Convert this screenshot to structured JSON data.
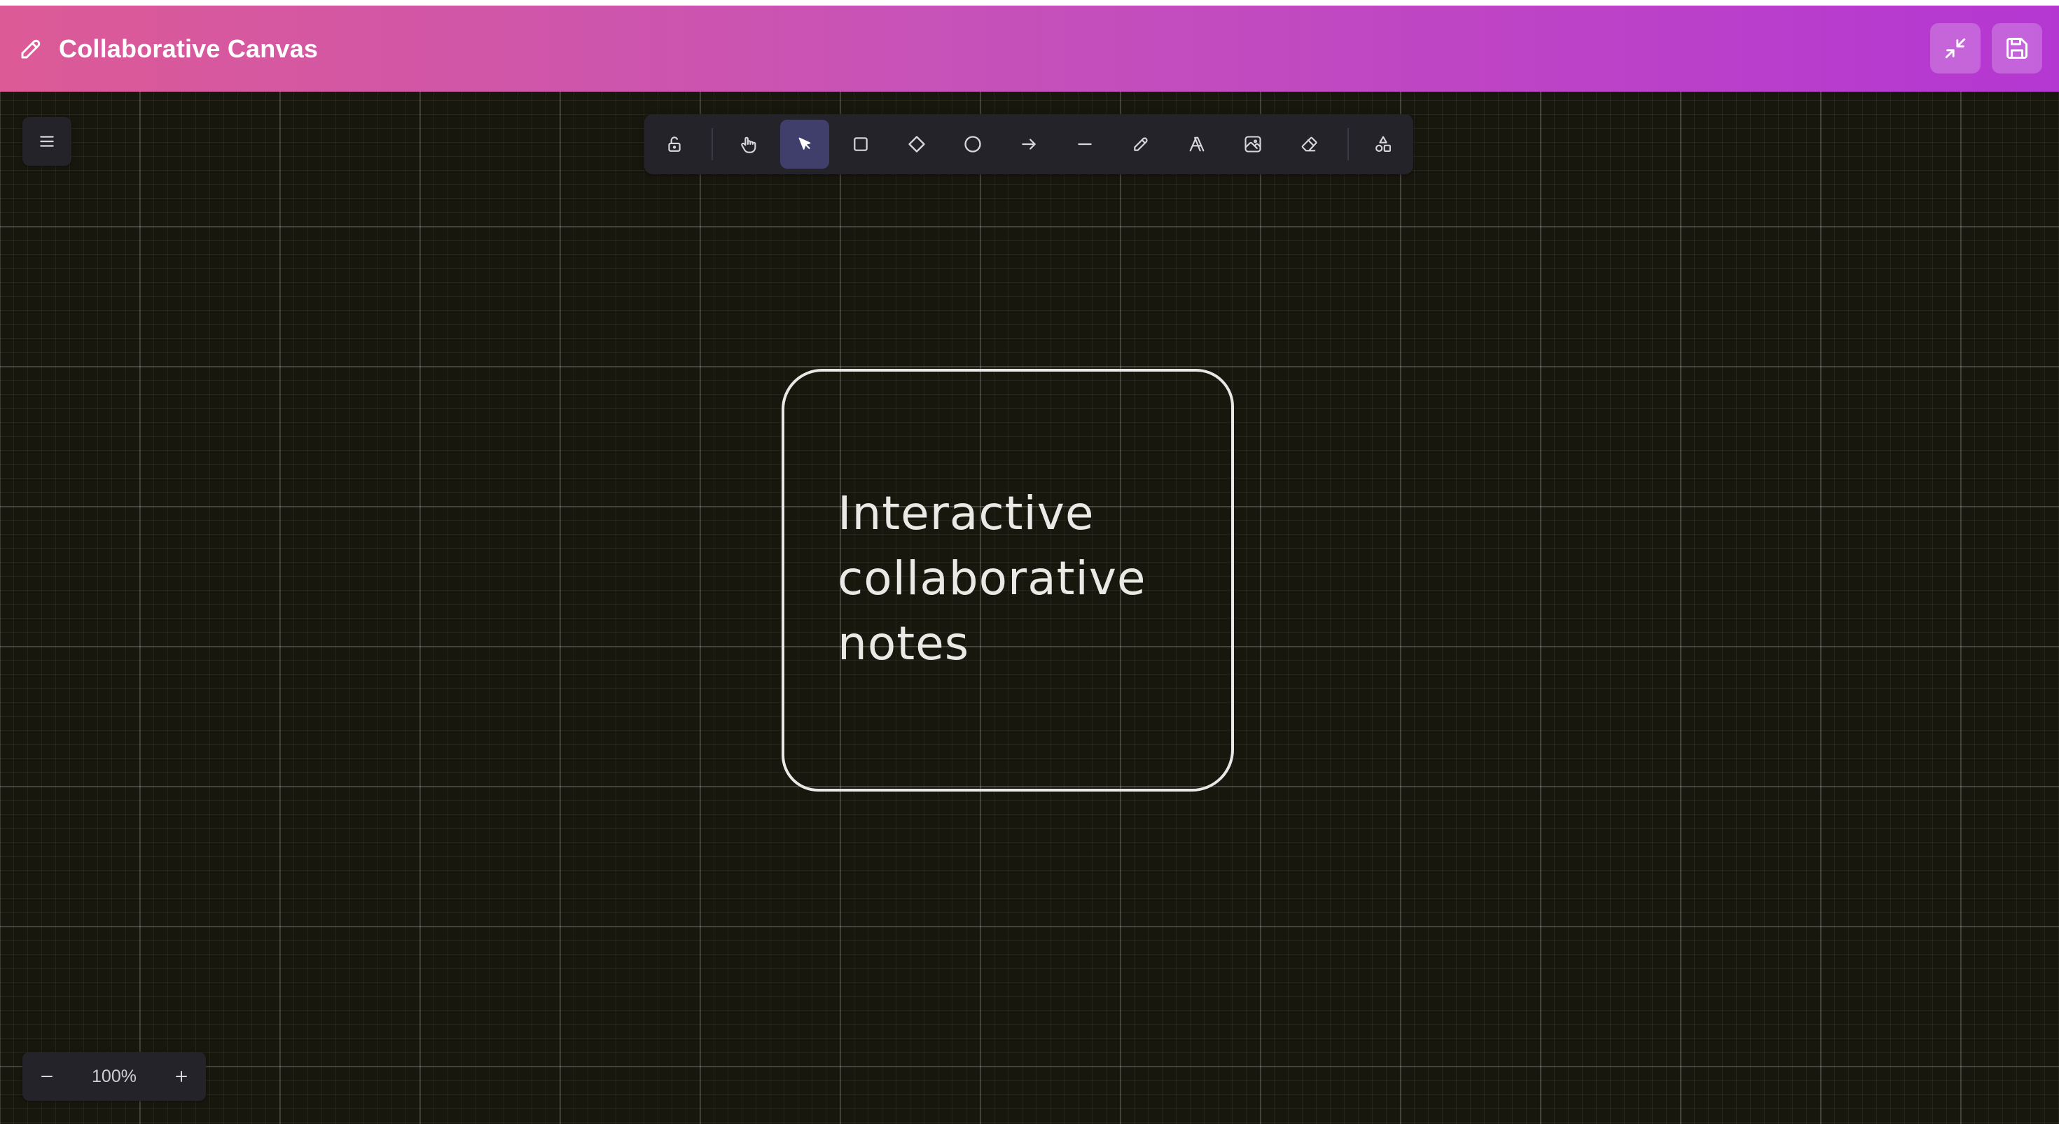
{
  "header": {
    "title": "Collaborative Canvas",
    "title_icon": "pencil-icon",
    "actions": [
      {
        "name": "minimize",
        "icon": "minimize-icon"
      },
      {
        "name": "save",
        "icon": "save-icon"
      }
    ]
  },
  "menu": {
    "icon": "hamburger-menu-icon"
  },
  "toolbar": {
    "tools": [
      {
        "name": "lock",
        "icon": "lock-open-icon",
        "active": false
      },
      {
        "name": "hand",
        "icon": "hand-icon",
        "active": false
      },
      {
        "name": "select",
        "icon": "pointer-icon",
        "active": true
      },
      {
        "name": "rectangle",
        "icon": "rectangle-icon",
        "active": false
      },
      {
        "name": "diamond",
        "icon": "diamond-icon",
        "active": false
      },
      {
        "name": "ellipse",
        "icon": "circle-icon",
        "active": false
      },
      {
        "name": "arrow",
        "icon": "arrow-right-icon",
        "active": false
      },
      {
        "name": "line",
        "icon": "line-icon",
        "active": false
      },
      {
        "name": "draw",
        "icon": "pencil-icon",
        "active": false
      },
      {
        "name": "text",
        "icon": "text-icon",
        "active": false
      },
      {
        "name": "image",
        "icon": "image-icon",
        "active": false
      },
      {
        "name": "eraser",
        "icon": "eraser-icon",
        "active": false
      },
      {
        "name": "library",
        "icon": "shapes-icon",
        "active": false
      }
    ]
  },
  "canvas": {
    "note": {
      "text": "Interactive\ncollaborative\nnotes"
    }
  },
  "zoom": {
    "level": "100%",
    "minus_icon": "minus-icon",
    "plus_icon": "plus-icon"
  },
  "colors": {
    "header_gradient_start": "#dc5a96",
    "header_gradient_end": "#b437d2",
    "canvas_background": "#18170d",
    "panel_background": "#232329",
    "active_tool": "#403e6a",
    "stroke": "#e8e8e6"
  }
}
